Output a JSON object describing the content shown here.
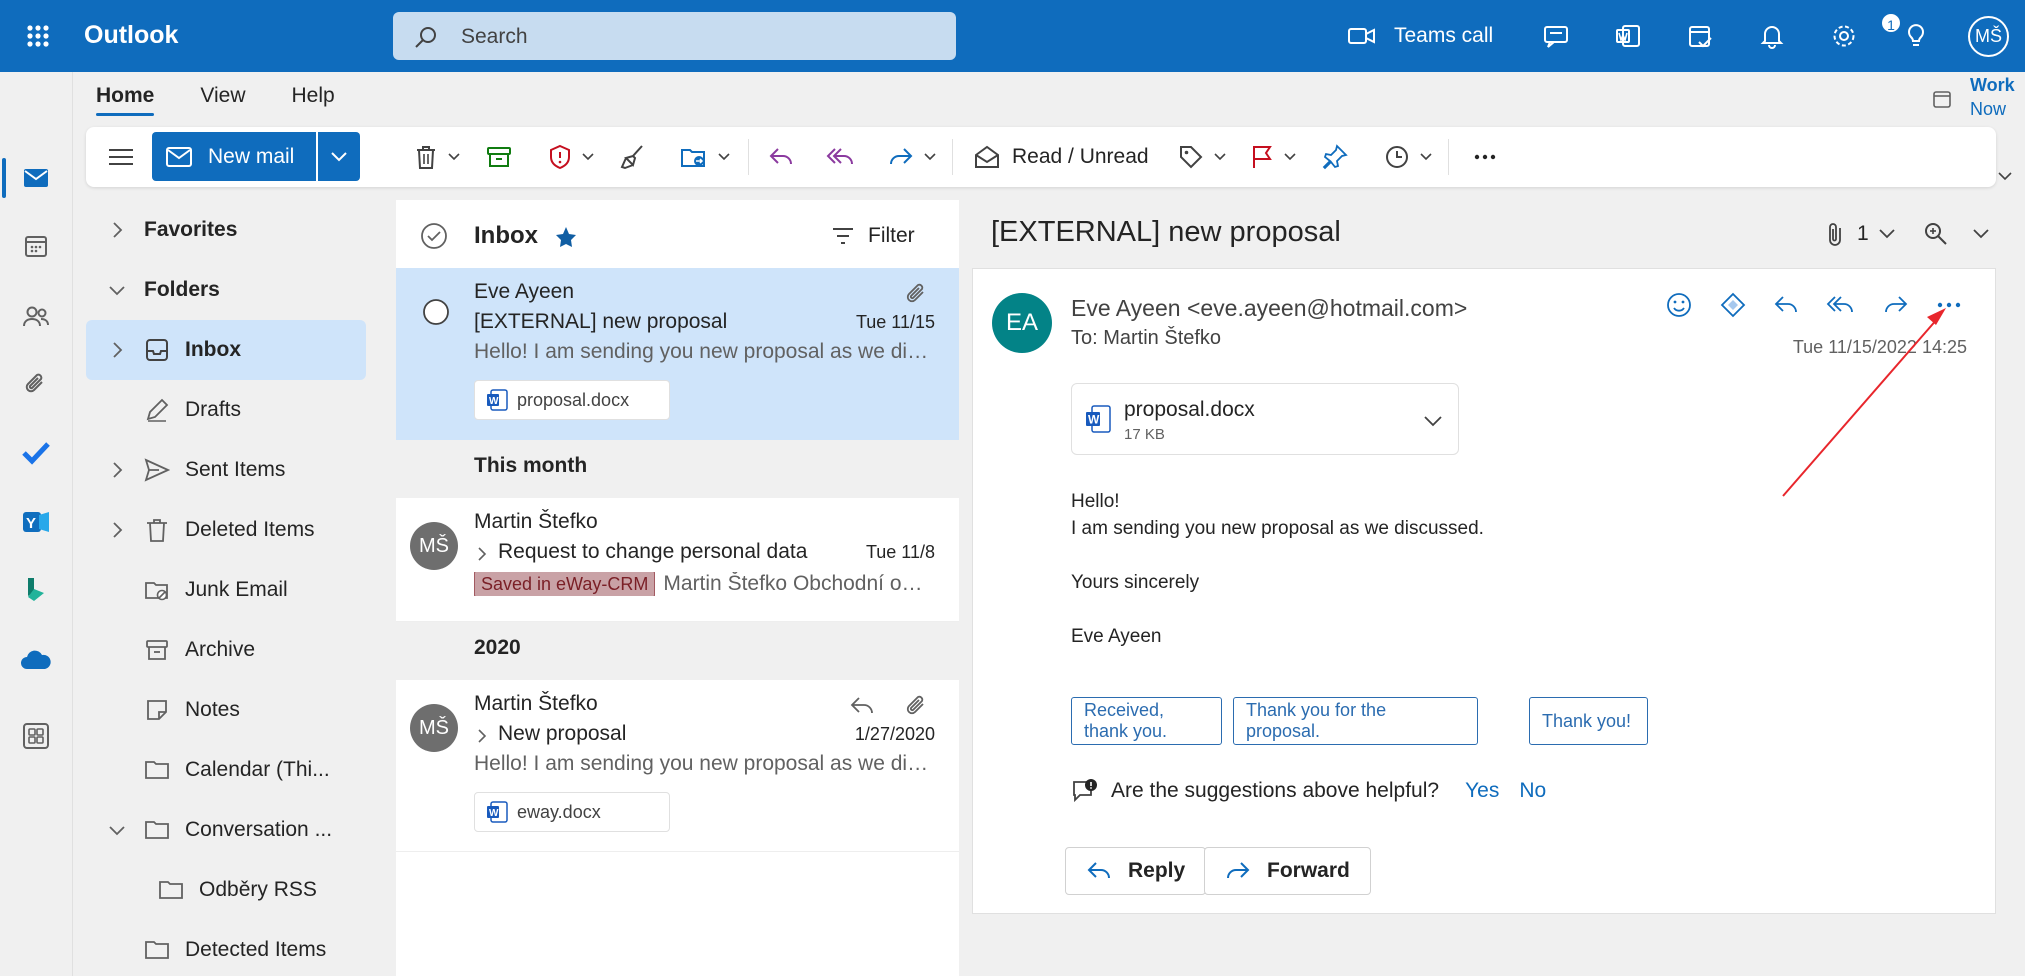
{
  "app": {
    "name": "Outlook"
  },
  "search": {
    "placeholder": "Search"
  },
  "header": {
    "teams_label": "Teams call",
    "notification_count": "1",
    "user_initials": "MŠ"
  },
  "ribbon": {
    "tabs": [
      "Home",
      "View",
      "Help"
    ],
    "new_mail": "New mail",
    "read_unread": "Read / Unread",
    "work_now": {
      "line1": "Work",
      "line2": "Now"
    }
  },
  "folders": {
    "favorites": "Favorites",
    "folders": "Folders",
    "items": [
      {
        "label": "Inbox",
        "icon": "inbox-icon"
      },
      {
        "label": "Drafts",
        "icon": "pencil-icon"
      },
      {
        "label": "Sent Items",
        "icon": "send-icon"
      },
      {
        "label": "Deleted Items",
        "icon": "trash-icon"
      },
      {
        "label": "Junk Email",
        "icon": "junk-icon"
      },
      {
        "label": "Archive",
        "icon": "archive-icon"
      },
      {
        "label": "Notes",
        "icon": "note-icon"
      },
      {
        "label": "Calendar (Thi...",
        "icon": "folder-icon"
      },
      {
        "label": "Conversation ...",
        "icon": "folder-icon"
      },
      {
        "label": "Odběry RSS",
        "icon": "folder-icon"
      },
      {
        "label": "Detected Items",
        "icon": "folder-icon"
      }
    ]
  },
  "list": {
    "title": "Inbox",
    "filter": "Filter",
    "groups": {
      "this_month": "This month",
      "year": "2020"
    },
    "messages": [
      {
        "from": "Eve Ayeen",
        "subject": "[EXTERNAL] new proposal",
        "date": "Tue 11/15",
        "preview": "Hello! I am sending you new proposal as we discussed.",
        "attachment": "proposal.docx"
      },
      {
        "from": "Martin Štefko",
        "initials": "MŠ",
        "subject": "Request to change personal data",
        "date": "Tue 11/8",
        "tag": "Saved in eWay-CRM",
        "preview": "Martin Štefko Obchodní oddělení"
      },
      {
        "from": "Martin Štefko",
        "initials": "MŠ",
        "subject": "New proposal",
        "date": "1/27/2020",
        "preview": "Hello! I am sending you new proposal as we discussed.",
        "attachment": "eway.docx"
      }
    ]
  },
  "reading": {
    "title": "[EXTERNAL] new proposal",
    "attach_count": "1",
    "sender_initials": "EA",
    "sender": "Eve Ayeen <eve.ayeen@hotmail.com>",
    "to": "To:  Martin Štefko",
    "date": "Tue 11/15/2022 14:25",
    "attachment": {
      "name": "proposal.docx",
      "size": "17 KB"
    },
    "body": [
      "Hello!",
      "I am sending you new proposal as we discussed.",
      "Yours sincerely",
      "Eve Ayeen"
    ],
    "suggestions": [
      "Received, thank you.",
      "Thank you for the proposal.",
      "Thank you!"
    ],
    "helpful_question": "Are the suggestions above helpful?",
    "yes": "Yes",
    "no": "No",
    "reply": "Reply",
    "forward": "Forward"
  },
  "colors": {
    "brand": "#0f6cbd",
    "selected": "#cfe4fa",
    "annotation": "#e8262c"
  }
}
